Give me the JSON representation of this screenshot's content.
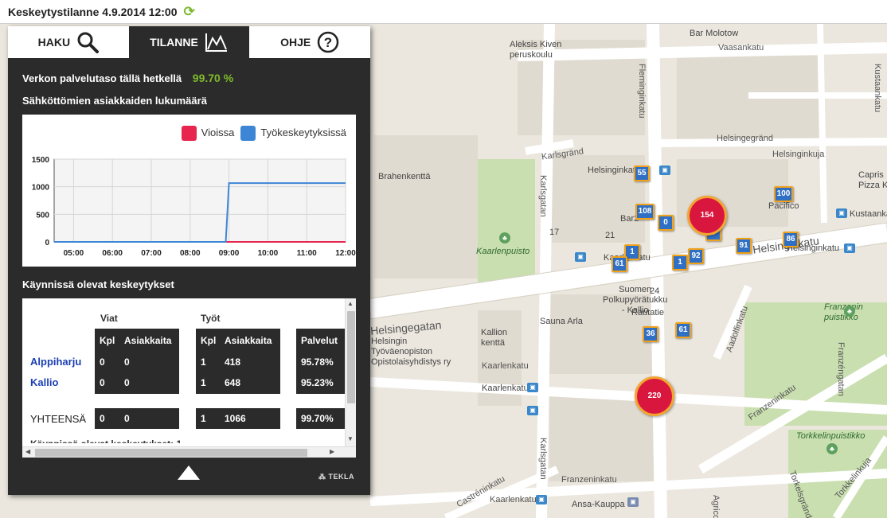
{
  "topbar": {
    "title": "Keskeytystilanne 4.9.2014 12:00",
    "refresh_icon": "refresh-icon"
  },
  "tabs": [
    {
      "label": "HAKU",
      "icon": "search-icon",
      "active": false
    },
    {
      "label": "TILANNE",
      "icon": "mountain-chart-icon",
      "active": true
    },
    {
      "label": "OHJE",
      "icon": "help-circle-icon",
      "active": false
    }
  ],
  "status": {
    "service_label": "Verkon palvelutaso tällä hetkellä",
    "service_value": "99.70 %",
    "chart_title": "Sähköttömien asiakkaiden lukumäärä",
    "ongoing_title": "Käynnissä olevat keskeytykset"
  },
  "colors": {
    "faults": "#e8254e",
    "work": "#3d86d6",
    "accent_green": "#7fba2c",
    "panel": "#2b2b2b"
  },
  "chart_data": {
    "type": "line",
    "x": [
      "04:30",
      "05:00",
      "05:30",
      "06:00",
      "06:30",
      "07:00",
      "07:30",
      "08:00",
      "08:30",
      "08:55",
      "09:00",
      "09:30",
      "10:00",
      "10:30",
      "11:00",
      "11:30",
      "12:00"
    ],
    "series": [
      {
        "name": "Vioissa",
        "color": "#e8254e",
        "values": [
          0,
          0,
          0,
          0,
          0,
          0,
          0,
          0,
          0,
          0,
          0,
          0,
          0,
          0,
          0,
          0,
          0
        ]
      },
      {
        "name": "Työkeskeytyksissä",
        "color": "#3d86d6",
        "values": [
          0,
          0,
          0,
          0,
          0,
          0,
          0,
          0,
          0,
          0,
          1066,
          1066,
          1066,
          1066,
          1066,
          1066,
          1066
        ]
      }
    ],
    "xticks": [
      "05:00",
      "06:00",
      "07:00",
      "08:00",
      "09:00",
      "10:00",
      "11:00",
      "12:00"
    ],
    "yticks": [
      "1500",
      "1000",
      "500",
      "0"
    ],
    "ylim": [
      0,
      1500
    ],
    "legend": [
      "Vioissa",
      "Työkeskeytyksissä"
    ],
    "legend_position": "top-right",
    "grid": true
  },
  "table": {
    "group_faults": "Viat",
    "group_work": "Työt",
    "col_kpl": "Kpl",
    "col_customers": "Asiakkaita",
    "col_service": "Palvelut",
    "rows": [
      {
        "area": "Alppiharju",
        "f_kpl": "0",
        "f_cust": "0",
        "w_kpl": "1",
        "w_cust": "418",
        "service": "95.78%"
      },
      {
        "area": "Kallio",
        "f_kpl": "0",
        "f_cust": "0",
        "w_kpl": "1",
        "w_cust": "648",
        "service": "95.23%"
      }
    ],
    "total": {
      "label": "YHTEENSÄ",
      "f_kpl": "0",
      "f_cust": "0",
      "w_kpl": "1",
      "w_cust": "1066",
      "service": "99.70%"
    },
    "cutoff_text": "Käynnissä olevat keskeytykset: 1"
  },
  "footer": {
    "collapse_icon": "triangle-up-icon",
    "brand": "TEKLA"
  },
  "map": {
    "streets": [
      {
        "name": "Vaasankatu"
      },
      {
        "name": "Helsingegränd"
      },
      {
        "name": "Helsinginkuja"
      },
      {
        "name": "Karlsgränd"
      },
      {
        "name": "Helsinginkatu"
      },
      {
        "name": "Fleminginkatu"
      },
      {
        "name": "Karlsgatan"
      },
      {
        "name": "Karlsgatan"
      },
      {
        "name": "Kaarlenkatu"
      },
      {
        "name": "Kustaankatu"
      },
      {
        "name": "Aadolfinkatu"
      },
      {
        "name": "Franzeninkatu"
      },
      {
        "name": "Franzéngatan"
      },
      {
        "name": "Torkkelinkuja"
      },
      {
        "name": "Castréninkatu"
      },
      {
        "name": "Kaarlenkatu"
      },
      {
        "name": "Helsingegatan"
      },
      {
        "name": "Franzeninkatu"
      },
      {
        "name": "Agricol"
      },
      {
        "name": "Torkelsgränd"
      }
    ],
    "pois": [
      {
        "name": "Bar Molotow"
      },
      {
        "name": "Aleksis Kiven\nperuskoulu"
      },
      {
        "name": "Kaarlenpuisto"
      },
      {
        "name": "Pacifico"
      },
      {
        "name": "Capris\nPizza Kebab"
      },
      {
        "name": "Bar2"
      },
      {
        "name": "Suomen\nPolkupyörätukku\n- Kallio"
      },
      {
        "name": "Sauna Arla"
      },
      {
        "name": "Kallion\nkenttä"
      },
      {
        "name": "Helsingin\nTyöväenopiston\nOpistolaisyhdistys ry"
      },
      {
        "name": "Franzenin\npuistikko"
      },
      {
        "name": "Torkkelinpuistikko"
      },
      {
        "name": "Ansa-Kauppa"
      },
      {
        "name": "Brahenkenttä"
      },
      {
        "name": "Helsinginkatu"
      },
      {
        "name": "Helsinginkatu"
      },
      {
        "name": "Kustaankatu"
      },
      {
        "name": "Kaarlenkatu"
      },
      {
        "name": "Kaarlenkatu"
      },
      {
        "name": "Rautatie"
      }
    ],
    "markers_square": [
      "55",
      "108",
      "0",
      "0",
      "1",
      "61",
      "1",
      "92",
      "91",
      "86",
      "100",
      "36",
      "61"
    ],
    "markers_circle": [
      "154",
      "220"
    ],
    "numbers": [
      "17",
      "21",
      "24"
    ]
  }
}
